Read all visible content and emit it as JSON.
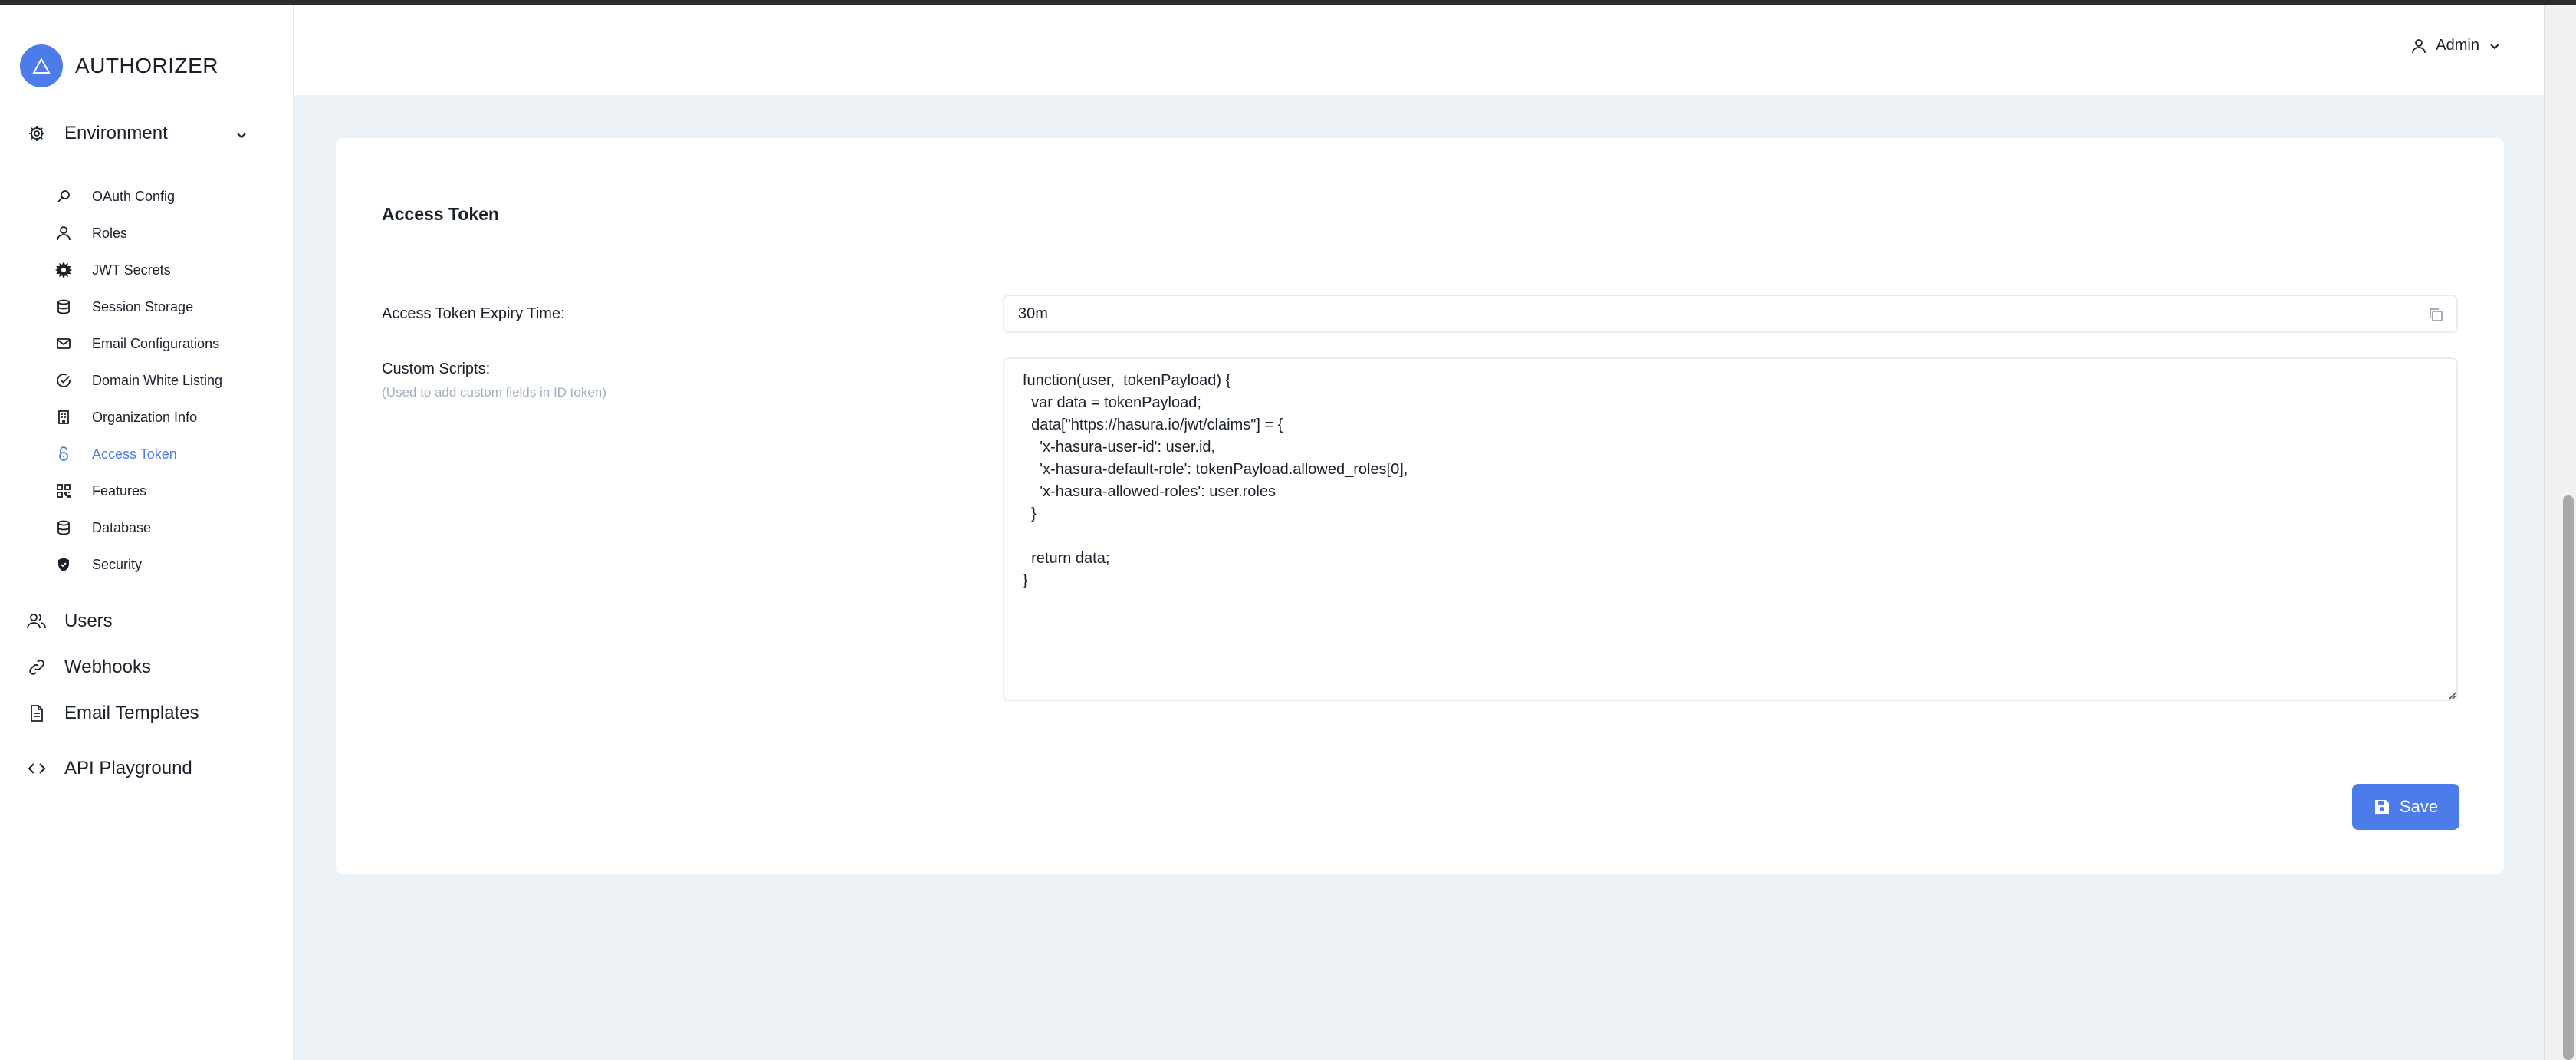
{
  "brand": {
    "name": "AUTHORIZER"
  },
  "sidebar": {
    "environment_label": "Environment",
    "sub_items": [
      {
        "label": "OAuth Config",
        "icon": "key-icon"
      },
      {
        "label": "Roles",
        "icon": "user-icon"
      },
      {
        "label": "JWT Secrets",
        "icon": "gear-burst-icon"
      },
      {
        "label": "Session Storage",
        "icon": "database-icon"
      },
      {
        "label": "Email Configurations",
        "icon": "mail-icon"
      },
      {
        "label": "Domain White Listing",
        "icon": "check-circle-icon"
      },
      {
        "label": "Organization Info",
        "icon": "building-icon"
      },
      {
        "label": "Access Token",
        "icon": "lock-icon",
        "active": true
      },
      {
        "label": "Features",
        "icon": "grid-icon"
      },
      {
        "label": "Database",
        "icon": "database-icon"
      },
      {
        "label": "Security",
        "icon": "shield-icon"
      }
    ],
    "users_label": "Users",
    "webhooks_label": "Webhooks",
    "email_templates_label": "Email Templates",
    "api_playground_label": "API Playground"
  },
  "header": {
    "user_label": "Admin"
  },
  "page": {
    "title": "Access Token",
    "expiry_label": "Access Token Expiry Time:",
    "expiry_value": "30m",
    "scripts_label": "Custom Scripts:",
    "scripts_help": "(Used to add custom fields in ID token)",
    "scripts_value": "function(user,  tokenPayload) {\n  var data = tokenPayload;\n  data[\"https://hasura.io/jwt/claims\"] = {\n    'x-hasura-user-id': user.id,\n    'x-hasura-default-role': tokenPayload.allowed_roles[0],\n    'x-hasura-allowed-roles': user.roles\n  }\n\n  return data;\n}",
    "save_label": "Save"
  },
  "colors": {
    "accent": "#4c7bea",
    "background": "#edf2f7"
  }
}
